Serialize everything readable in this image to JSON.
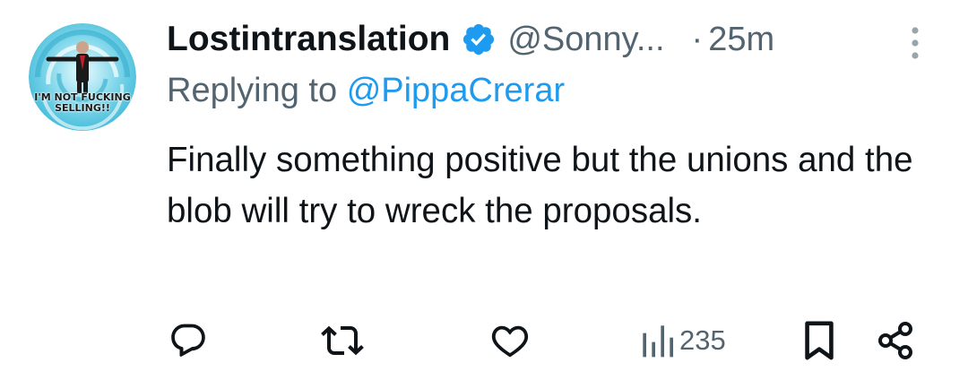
{
  "tweet": {
    "avatar": {
      "icon": "profile-avatar",
      "caption_line1": "I'M NOT FUCKING",
      "caption_line2": "SELLING!!"
    },
    "display_name": "Lostintranslation",
    "verified_icon": "verified-badge-icon",
    "handle": "@Sonny...",
    "separator": "·",
    "time": "25m",
    "replying_prefix": "Replying to",
    "replying_handle": "@PippaCrerar",
    "text": "Finally something positive but the unions and the blob will try to wreck the proposals.",
    "actions": {
      "reply_icon": "reply-icon",
      "retweet_icon": "retweet-icon",
      "like_icon": "heart-icon",
      "views_icon": "views-icon",
      "views_count": "235",
      "bookmark_icon": "bookmark-icon",
      "share_icon": "share-icon"
    }
  },
  "colors": {
    "text_primary": "#0f1419",
    "text_secondary": "#536471",
    "link_blue": "#1d9bf0",
    "verified_blue": "#1d9bf0"
  }
}
